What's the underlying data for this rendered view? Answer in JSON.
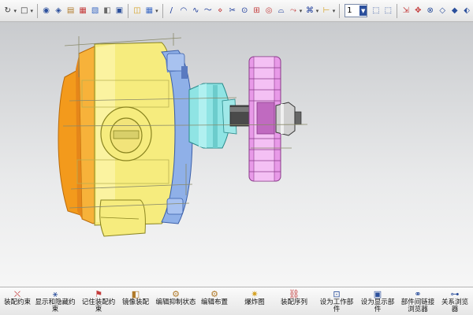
{
  "toolbar": {
    "zoom_value": "1",
    "icons": {
      "snap": "↻",
      "select": "□",
      "view1": "◉",
      "view2": "◈",
      "view3": "▤",
      "view4": "▦",
      "view5": "▧",
      "view6": "◧",
      "view7": "▣",
      "view8": "◫",
      "line": "/",
      "arc": "◠",
      "spline": "∿",
      "curve": "〜",
      "offset": "⋄",
      "trim": "✂",
      "point": "⊙",
      "pattern": "⊞",
      "circle": "◎",
      "fillet": "⌓",
      "extend": "⤳",
      "project": "⌘",
      "dims": "⊢",
      "a1": "⬚",
      "a2": "⬚",
      "a3": "⇲",
      "a4": "✥",
      "a5": "⊗",
      "a6": "◇",
      "a7": "◆",
      "a8": "⬖"
    }
  },
  "bottom": {
    "items": [
      {
        "label": "装配约束",
        "icon": "⛌"
      },
      {
        "label": "显示和隐藏约束",
        "icon": "⚹"
      },
      {
        "label": "记住装配约束",
        "icon": "⚑"
      },
      {
        "label": "镜像装配",
        "icon": "◧"
      },
      {
        "label": "编辑抑制状态",
        "icon": "⚙"
      },
      {
        "label": "编辑布置",
        "icon": "⚙"
      },
      {
        "label": "爆炸图",
        "icon": "✷"
      },
      {
        "label": "装配序列",
        "icon": "⛓"
      },
      {
        "label": "设为工作部件",
        "icon": "⊡"
      },
      {
        "label": "设为显示部件",
        "icon": "▣"
      },
      {
        "label": "部件间链接浏览器",
        "icon": "⚭"
      },
      {
        "label": "关系浏览器",
        "icon": "⊶"
      }
    ]
  },
  "colors": {
    "orange": "#f39a1c",
    "yellow": "#f6ec7e",
    "blue": "#8fb0e8",
    "cyan": "#8fe4e4",
    "shaft": "#4a4a4a",
    "gear": "#e89ae8",
    "toolbar_accent": "#2b4f9c"
  }
}
